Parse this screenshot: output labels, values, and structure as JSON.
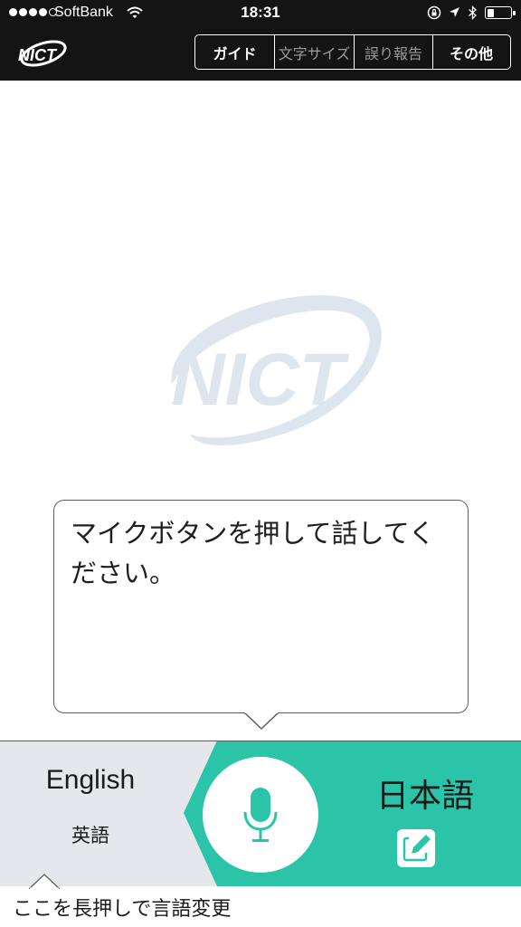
{
  "status_bar": {
    "carrier": "SoftBank",
    "time": "18:31",
    "battery_level": 0.3
  },
  "nav": {
    "logo_text": "NICT",
    "tabs": [
      {
        "label": "ガイド",
        "active": true
      },
      {
        "label": "文字サイズ",
        "active": false
      },
      {
        "label": "誤り報告",
        "active": false
      },
      {
        "label": "その他",
        "active": true
      }
    ]
  },
  "watermark": {
    "logo_text": "NICT"
  },
  "bubble": {
    "message": "マイクボタンを押して話してください。"
  },
  "language_panel": {
    "source_language": "English",
    "source_language_native": "英語",
    "target_language": "日本語"
  },
  "hint": "ここを長押しで言語変更",
  "colors": {
    "nav_background": "#141414",
    "accent": "#2bc4a8",
    "source_panel": "#e6e7ec",
    "logo_watermark": "#dde5ee"
  },
  "icons": [
    "wifi-icon",
    "rotation-lock-icon",
    "location-arrow-icon",
    "bluetooth-icon",
    "battery-icon",
    "microphone-icon",
    "edit-icon"
  ]
}
